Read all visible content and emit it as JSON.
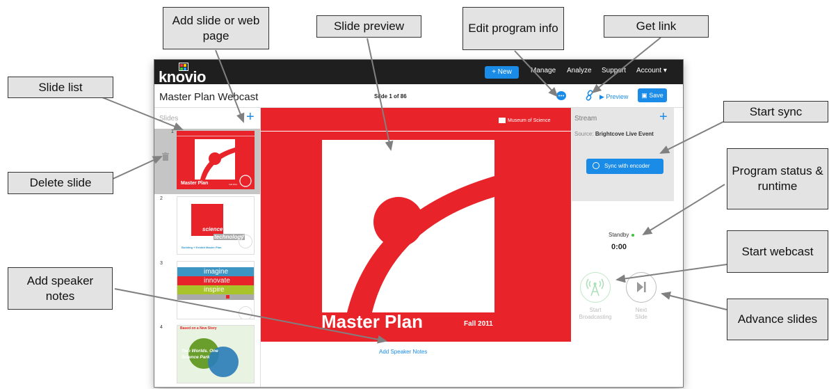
{
  "app": {
    "logo_text": "knovio",
    "new_label": "+ New",
    "nav": [
      "Manage",
      "Analyze",
      "Support",
      "Account ▾"
    ],
    "program_title": "Master Plan Webcast",
    "slide_counter": "Slide 1 of 86",
    "preview_label": "▶ Preview",
    "save_label": "Save",
    "colors": {
      "accent": "#1a8be6",
      "topbar": "#1f1f1f",
      "slide_red": "#e8232a"
    }
  },
  "slides_panel": {
    "label": "Slides",
    "add_icon": "plus-icon",
    "delete_icon": "trash-icon",
    "thumbnails": [
      {
        "number": "1",
        "title": "Master Plan",
        "subtitle": "Fall 2011"
      },
      {
        "number": "2",
        "text1": "science",
        "text2": "technology",
        "caption": "Building + Exhibit Master Plan"
      },
      {
        "number": "3",
        "lines": [
          "imagine",
          "innovate",
          "inspire"
        ]
      },
      {
        "number": "4",
        "header": "Based on a New Story",
        "body": "Two Worlds. One Science Park"
      }
    ]
  },
  "preview": {
    "org": "Museum of Science",
    "title": "Master Plan",
    "date": "Fall 2011",
    "speaker_notes_link": "Add Speaker Notes"
  },
  "stream_panel": {
    "label": "Stream",
    "source_label": "Source:",
    "source_value": "Brightcove Live Event",
    "sync_label": "Sync with encoder",
    "status": "Standby",
    "runtime": "0:00",
    "start_label_1": "Start",
    "start_label_2": "Broadcasting",
    "next_label_1": "Next",
    "next_label_2": "Slide"
  },
  "callouts": {
    "add_slide": "Add slide or web page",
    "slide_preview": "Slide preview",
    "edit_info": "Edit program info",
    "get_link": "Get link",
    "slide_list": "Slide list",
    "start_sync": "Start sync",
    "delete_slide": "Delete slide",
    "program_status": "Program status & runtime",
    "start_webcast": "Start webcast",
    "add_notes": "Add speaker notes",
    "advance": "Advance slides"
  }
}
